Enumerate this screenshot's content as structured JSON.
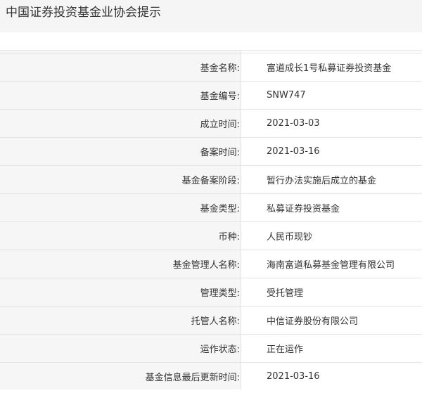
{
  "header": {
    "title": "中国证券投资基金业协会提示"
  },
  "rows": [
    {
      "label": "基金名称:",
      "value": "富道成长1号私募证券投资基金"
    },
    {
      "label": "基金编号:",
      "value": "SNW747"
    },
    {
      "label": "成立时间:",
      "value": "2021-03-03"
    },
    {
      "label": "备案时间:",
      "value": "2021-03-16"
    },
    {
      "label": "基金备案阶段:",
      "value": "暂行办法实施后成立的基金"
    },
    {
      "label": "基金类型:",
      "value": "私募证券投资基金"
    },
    {
      "label": "币种:",
      "value": "人民币现钞"
    },
    {
      "label": "基金管理人名称:",
      "value": "海南富道私募基金管理有限公司"
    },
    {
      "label": "管理类型:",
      "value": "受托管理"
    },
    {
      "label": "托管人名称:",
      "value": "中信证券股份有限公司"
    },
    {
      "label": "运作状态:",
      "value": "正在运作"
    },
    {
      "label": "基金信息最后更新时间:",
      "value": "2021-03-16"
    }
  ]
}
